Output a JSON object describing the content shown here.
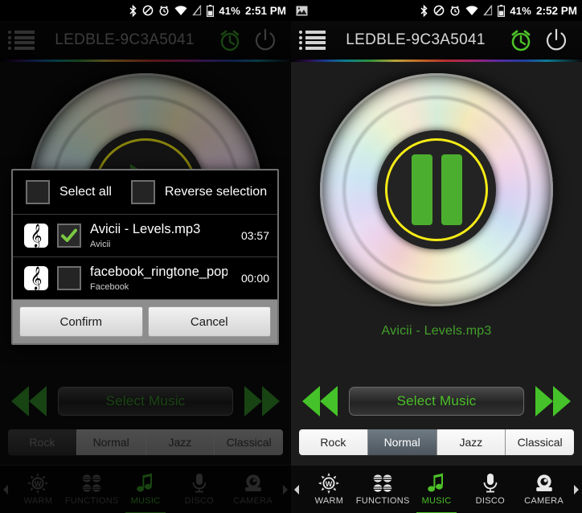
{
  "left": {
    "statusbar": {
      "icons": [
        "bluetooth-icon",
        "mute-icon",
        "alarm-icon",
        "wifi-icon",
        "signal-off-icon",
        "battery-icon"
      ],
      "battery": "41%",
      "time": "2:51 PM"
    },
    "titlebar": {
      "menu_icon": "list-menu-icon",
      "title": "LEDBLE-9C3A5041",
      "alarm_icon": "alarm-clock-icon",
      "power_icon": "power-icon"
    },
    "player": {
      "disc_icon": "cd-disc-icon",
      "state_icon": "play-icon",
      "now_playing": ""
    },
    "transport": {
      "prev_label": "previous-icon",
      "select_music": "Select Music",
      "next_label": "next-icon"
    },
    "eq": {
      "tabs": [
        "Rock",
        "Normal",
        "Jazz",
        "Classical"
      ],
      "active": 0
    },
    "nav": {
      "items": [
        {
          "label": "WARM",
          "icon": "warm-sun-icon"
        },
        {
          "label": "FUNCTIONS",
          "icon": "functions-grid-icon"
        },
        {
          "label": "MUSIC",
          "icon": "music-note-icon"
        },
        {
          "label": "DISCO",
          "icon": "microphone-icon"
        },
        {
          "label": "CAMERA",
          "icon": "camera-icon"
        }
      ],
      "active": 2,
      "left_arrow": "chevron-left-icon",
      "right_arrow": "chevron-right-icon"
    },
    "dialog": {
      "select_all": "Select all",
      "reverse_selection": "Reverse selection",
      "tracks": [
        {
          "title": "Avicii - Levels.mp3",
          "artist": "Avicii",
          "duration": "03:57",
          "checked": true,
          "icon": "music-clef-icon"
        },
        {
          "title": "facebook_ringtone_pop.m",
          "artist": "Facebook",
          "duration": "00:00",
          "checked": false,
          "icon": "music-clef-icon"
        }
      ],
      "confirm": "Confirm",
      "cancel": "Cancel"
    }
  },
  "right": {
    "statusbar": {
      "notification_icon": "image-notification-icon",
      "icons": [
        "bluetooth-icon",
        "mute-icon",
        "alarm-icon",
        "wifi-icon",
        "signal-off-icon",
        "battery-icon"
      ],
      "battery": "41%",
      "time": "2:52 PM"
    },
    "titlebar": {
      "menu_icon": "list-menu-icon",
      "title": "LEDBLE-9C3A5041",
      "alarm_icon": "alarm-clock-icon",
      "power_icon": "power-icon"
    },
    "player": {
      "disc_icon": "cd-disc-icon",
      "state_icon": "pause-icon",
      "now_playing": "Avicii - Levels.mp3"
    },
    "transport": {
      "prev_label": "previous-icon",
      "select_music": "Select Music",
      "next_label": "next-icon"
    },
    "eq": {
      "tabs": [
        "Rock",
        "Normal",
        "Jazz",
        "Classical"
      ],
      "active": 1
    },
    "nav": {
      "items": [
        {
          "label": "WARM",
          "icon": "warm-sun-icon"
        },
        {
          "label": "FUNCTIONS",
          "icon": "functions-grid-icon"
        },
        {
          "label": "MUSIC",
          "icon": "music-note-icon"
        },
        {
          "label": "DISCO",
          "icon": "microphone-icon"
        },
        {
          "label": "CAMERA",
          "icon": "camera-icon"
        }
      ],
      "active": 2,
      "left_arrow": "chevron-left-icon",
      "right_arrow": "chevron-right-icon"
    }
  },
  "colors": {
    "accent_green": "#4cc028",
    "dim_green": "#2f7d1f",
    "ring_yellow": "#f5eb16",
    "bg": "#0b0b0b"
  }
}
